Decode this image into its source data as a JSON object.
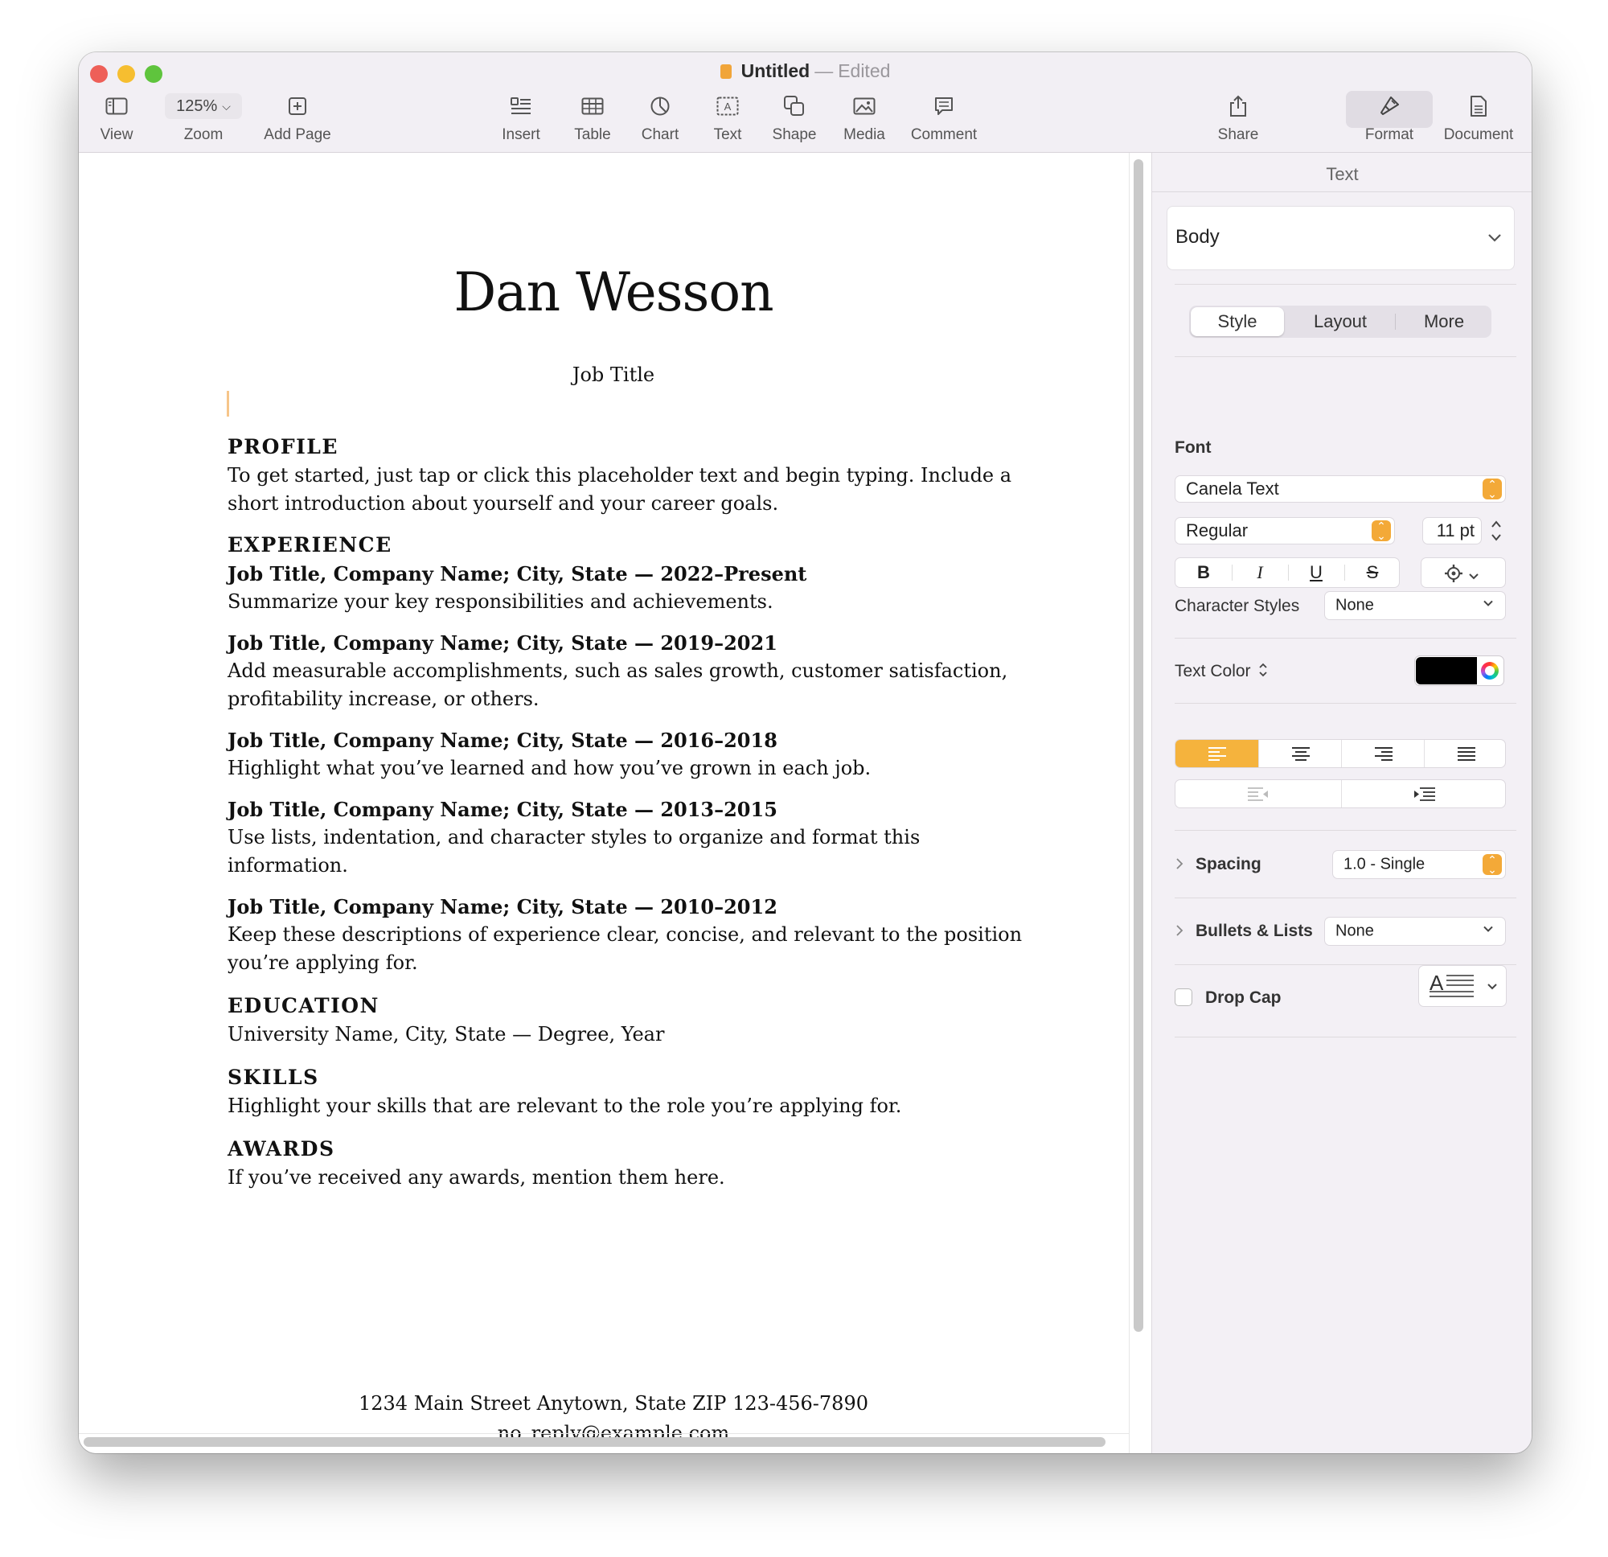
{
  "window": {
    "title": "Untitled",
    "title_separator": "—",
    "title_status": "Edited"
  },
  "toolbar": {
    "view_label": "View",
    "zoom_value": "125%",
    "zoom_label": "Zoom",
    "add_page_label": "Add Page",
    "insert_label": "Insert",
    "table_label": "Table",
    "chart_label": "Chart",
    "text_label": "Text",
    "shape_label": "Shape",
    "media_label": "Media",
    "comment_label": "Comment",
    "share_label": "Share",
    "format_label": "Format",
    "document_label": "Document"
  },
  "resume": {
    "name": "Dan Wesson",
    "job_title": "Job Title",
    "profile_heading": "PROFILE",
    "profile_text": "To get started, just tap or click this placeholder text and begin typing. Include a short introduction about yourself and your career goals.",
    "experience_heading": "EXPERIENCE",
    "jobs": [
      {
        "title": "Job Title, Company Name; City, State — 2022–Present",
        "desc": "Summarize your key responsibilities and achievements."
      },
      {
        "title": "Job Title, Company Name; City, State — 2019–2021",
        "desc": "Add measurable accomplishments, such as sales growth, customer satisfaction, profitability increase, or others."
      },
      {
        "title": "Job Title, Company Name; City, State — 2016–2018",
        "desc": "Highlight what you’ve learned and how you’ve grown in each job."
      },
      {
        "title": "Job Title, Company Name; City, State — 2013–2015",
        "desc": "Use lists, indentation, and character styles to organize and format this information."
      },
      {
        "title": "Job Title, Company Name; City, State — 2010–2012",
        "desc": "Keep these descriptions of experience clear, concise, and relevant to the position you’re applying for."
      }
    ],
    "education_heading": "EDUCATION",
    "education_text": "University Name, City, State — Degree, Year",
    "skills_heading": "SKILLS",
    "skills_text": "Highlight your skills that are relevant to the role you’re applying for.",
    "awards_heading": "AWARDS",
    "awards_text": "If you’ve received any awards, mention them here.",
    "footer_address": "1234 Main Street Anytown, State ZIP   123-456-7890",
    "footer_email": "no_reply@example.com"
  },
  "inspector": {
    "title": "Text",
    "paragraph_style": "Body",
    "tabs": [
      "Style",
      "Layout",
      "More"
    ],
    "active_tab": "Style",
    "font_label": "Font",
    "font_family": "Canela Text",
    "font_typeface": "Regular",
    "font_size": "11 pt",
    "bold_label": "B",
    "italic_label": "I",
    "underline_label": "U",
    "strike_label": "S",
    "character_styles_label": "Character Styles",
    "character_styles_value": "None",
    "text_color_label": "Text Color",
    "text_color": "#000000",
    "alignment_selected": "left",
    "spacing_label": "Spacing",
    "spacing_value": "1.0 - Single",
    "bullets_label": "Bullets & Lists",
    "bullets_value": "None",
    "drop_cap_label": "Drop Cap",
    "drop_cap_checked": false,
    "accent_color": "#f5b33d"
  }
}
